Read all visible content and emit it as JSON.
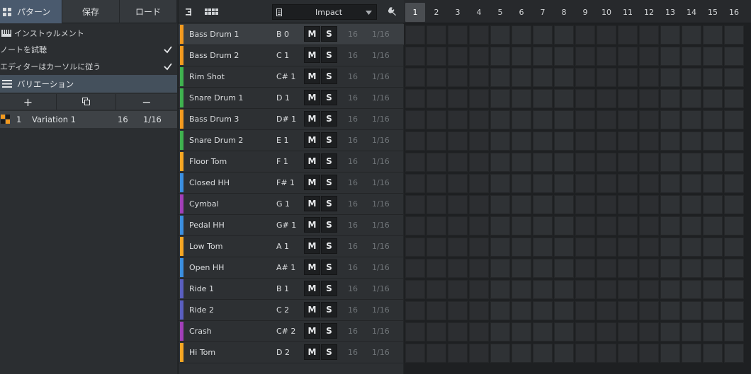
{
  "tabs": [
    {
      "label": "パターン",
      "active": true
    },
    {
      "label": "保存",
      "active": false
    },
    {
      "label": "ロード",
      "active": false
    }
  ],
  "options": {
    "instrument": "インストゥルメント",
    "audition_notes": "ノートを試聴",
    "editor_follows_cursor": "エディターはカーソルに従う"
  },
  "variations": {
    "header": "バリエーション",
    "add": "+",
    "minus": "−",
    "row": {
      "index": "1",
      "name": "Variation 1",
      "steps": "16",
      "resolution": "1/16"
    }
  },
  "toolbar": {
    "preset": "Impact"
  },
  "instruments": [
    {
      "name": "Bass Drum 1",
      "note": "B 0",
      "steps": "16",
      "res": "1/16",
      "color": "#f39a1f",
      "selected": true
    },
    {
      "name": "Bass Drum 2",
      "note": "C 1",
      "steps": "16",
      "res": "1/16",
      "color": "#f39a1f"
    },
    {
      "name": "Rim Shot",
      "note": "C# 1",
      "steps": "16",
      "res": "1/16",
      "color": "#3fb24f"
    },
    {
      "name": "Snare Drum 1",
      "note": "D 1",
      "steps": "16",
      "res": "1/16",
      "color": "#3fb24f"
    },
    {
      "name": "Bass Drum 3",
      "note": "D# 1",
      "steps": "16",
      "res": "1/16",
      "color": "#f39a1f"
    },
    {
      "name": "Snare Drum 2",
      "note": "E 1",
      "steps": "16",
      "res": "1/16",
      "color": "#3fb24f"
    },
    {
      "name": "Floor Tom",
      "note": "F 1",
      "steps": "16",
      "res": "1/16",
      "color": "#f5a623"
    },
    {
      "name": "Closed HH",
      "note": "F# 1",
      "steps": "16",
      "res": "1/16",
      "color": "#3b8fe0"
    },
    {
      "name": "Cymbal",
      "note": "G 1",
      "steps": "16",
      "res": "1/16",
      "color": "#a23fb8"
    },
    {
      "name": "Pedal HH",
      "note": "G# 1",
      "steps": "16",
      "res": "1/16",
      "color": "#3b8fe0"
    },
    {
      "name": "Low Tom",
      "note": "A 1",
      "steps": "16",
      "res": "1/16",
      "color": "#f5a623"
    },
    {
      "name": "Open HH",
      "note": "A# 1",
      "steps": "16",
      "res": "1/16",
      "color": "#3b8fe0"
    },
    {
      "name": "Ride 1",
      "note": "B 1",
      "steps": "16",
      "res": "1/16",
      "color": "#5a5fc0"
    },
    {
      "name": "Ride 2",
      "note": "C 2",
      "steps": "16",
      "res": "1/16",
      "color": "#5a5fc0"
    },
    {
      "name": "Crash",
      "note": "C# 2",
      "steps": "16",
      "res": "1/16",
      "color": "#a23fb8"
    },
    {
      "name": "Hi Tom",
      "note": "D 2",
      "steps": "16",
      "res": "1/16",
      "color": "#f5a623"
    }
  ],
  "mute_label": "M",
  "solo_label": "S",
  "steps": [
    "1",
    "2",
    "3",
    "4",
    "5",
    "6",
    "7",
    "8",
    "9",
    "10",
    "11",
    "12",
    "13",
    "14",
    "15",
    "16"
  ],
  "current_step": "1"
}
